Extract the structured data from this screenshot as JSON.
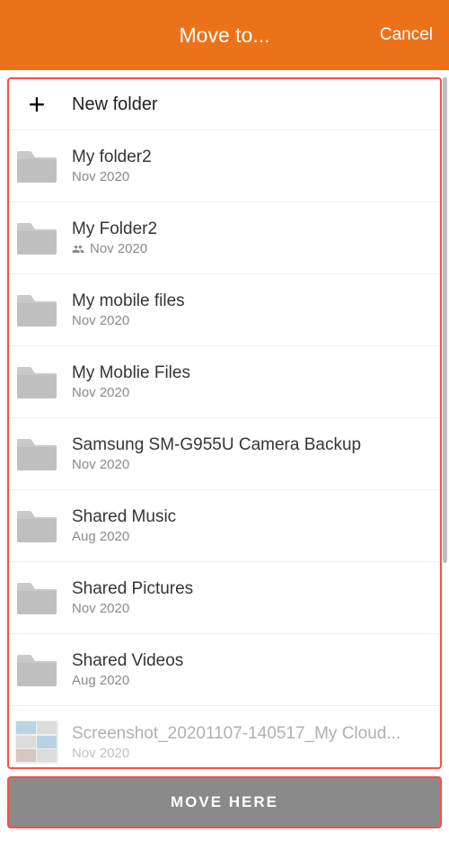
{
  "header": {
    "title": "Move to...",
    "cancel": "Cancel"
  },
  "new_folder_label": "New folder",
  "folders": [
    {
      "name": "My folder2",
      "date": "Nov 2020",
      "shared": false
    },
    {
      "name": "My Folder2",
      "date": "Nov 2020",
      "shared": true
    },
    {
      "name": "My mobile files",
      "date": "Nov 2020",
      "shared": false
    },
    {
      "name": "My Moblie Files",
      "date": "Nov 2020",
      "shared": false
    },
    {
      "name": "Samsung SM-G955U Camera Backup",
      "date": "Nov 2020",
      "shared": false
    },
    {
      "name": "Shared Music",
      "date": "Aug 2020",
      "shared": false
    },
    {
      "name": "Shared Pictures",
      "date": "Nov 2020",
      "shared": false
    },
    {
      "name": "Shared Videos",
      "date": "Aug 2020",
      "shared": false
    }
  ],
  "file": {
    "name": "Screenshot_20201107-140517_My Cloud...",
    "date": "Nov 2020"
  },
  "move_button": "MOVE HERE"
}
